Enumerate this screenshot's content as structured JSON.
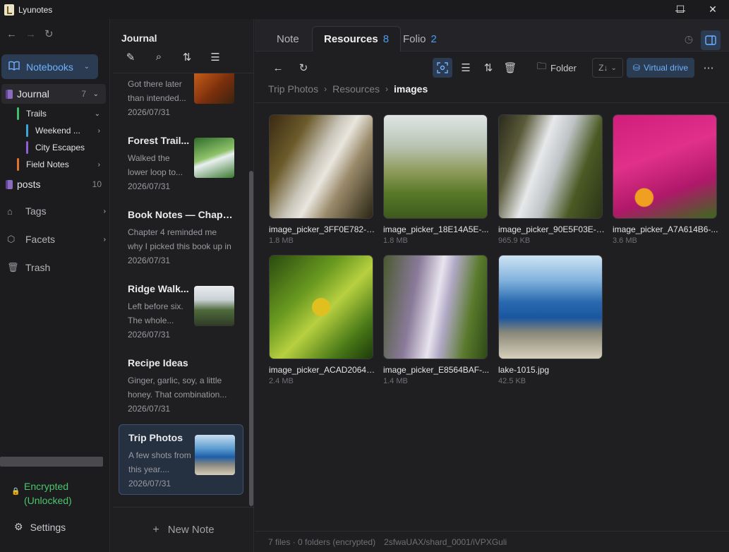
{
  "window": {
    "title": "Lyunotes",
    "minimize": "—",
    "maximize": "☐",
    "close": "✕"
  },
  "sidebar": {
    "notebooks_label": "Notebooks",
    "journal": {
      "label": "Journal",
      "count": "7"
    },
    "trails": {
      "label": "Trails",
      "color": "#3fbf6b"
    },
    "weekend": {
      "label": "Weekend ...",
      "color": "#3aa7d8"
    },
    "city": {
      "label": "City Escapes",
      "color": "#8f5fd6"
    },
    "field": {
      "label": "Field Notes",
      "color": "#e0742e"
    },
    "posts": {
      "label": "posts",
      "count": "10"
    },
    "tags": "Tags",
    "facets": "Facets",
    "trash": "Trash",
    "encrypted": "Encrypted",
    "unlocked": "(Unlocked)",
    "settings": "Settings"
  },
  "notelist": {
    "title": "Journal",
    "new_note": "New Note",
    "notes": [
      {
        "title": "",
        "snippet": "Got there later than intended...",
        "date": "2026/07/31"
      },
      {
        "title": "Forest Trail...",
        "snippet": "Walked the lower loop to...",
        "date": "2026/07/31"
      },
      {
        "title": "Book Notes — Chapt...",
        "snippet": "Chapter 4 reminded me why I picked this book up in th...",
        "date": "2026/07/31"
      },
      {
        "title": "Ridge Walk...",
        "snippet": "Left before six. The whole...",
        "date": "2026/07/31"
      },
      {
        "title": "Recipe Ideas",
        "snippet": "Ginger, garlic, soy, a little honey. That combination...",
        "date": "2026/07/31"
      },
      {
        "title": "Trip Photos",
        "snippet": "A few shots from this year....",
        "date": "2026/07/31"
      }
    ]
  },
  "tabs": {
    "note": "Note",
    "resources": "Resources",
    "resources_count": "8",
    "folio": "Folio",
    "folio_count": "2"
  },
  "toolbar": {
    "folder": "Folder",
    "sort_select": "Z↓",
    "virtual_drive": "Virtual drive"
  },
  "breadcrumb": {
    "root": "Trip Photos",
    "mid": "Resources",
    "current": "images"
  },
  "files": [
    {
      "name": "image_picker_3FF0E782-C...",
      "size": "1.8 MB"
    },
    {
      "name": "image_picker_18E14A5E-...",
      "size": "1.8 MB"
    },
    {
      "name": "image_picker_90E5F03E-A...",
      "size": "965.9 KB"
    },
    {
      "name": "image_picker_A7A614B6-...",
      "size": "3.6 MB"
    },
    {
      "name": "image_picker_ACAD2064-...",
      "size": "2.4 MB"
    },
    {
      "name": "image_picker_E8564BAF-...",
      "size": "1.4 MB"
    },
    {
      "name": "lake-1015.jpg",
      "size": "42.5 KB"
    }
  ],
  "status": {
    "summary": "7 files · 0 folders (encrypted)",
    "path": "2sfwaUAX/shard_0001/iVPXGuli"
  }
}
